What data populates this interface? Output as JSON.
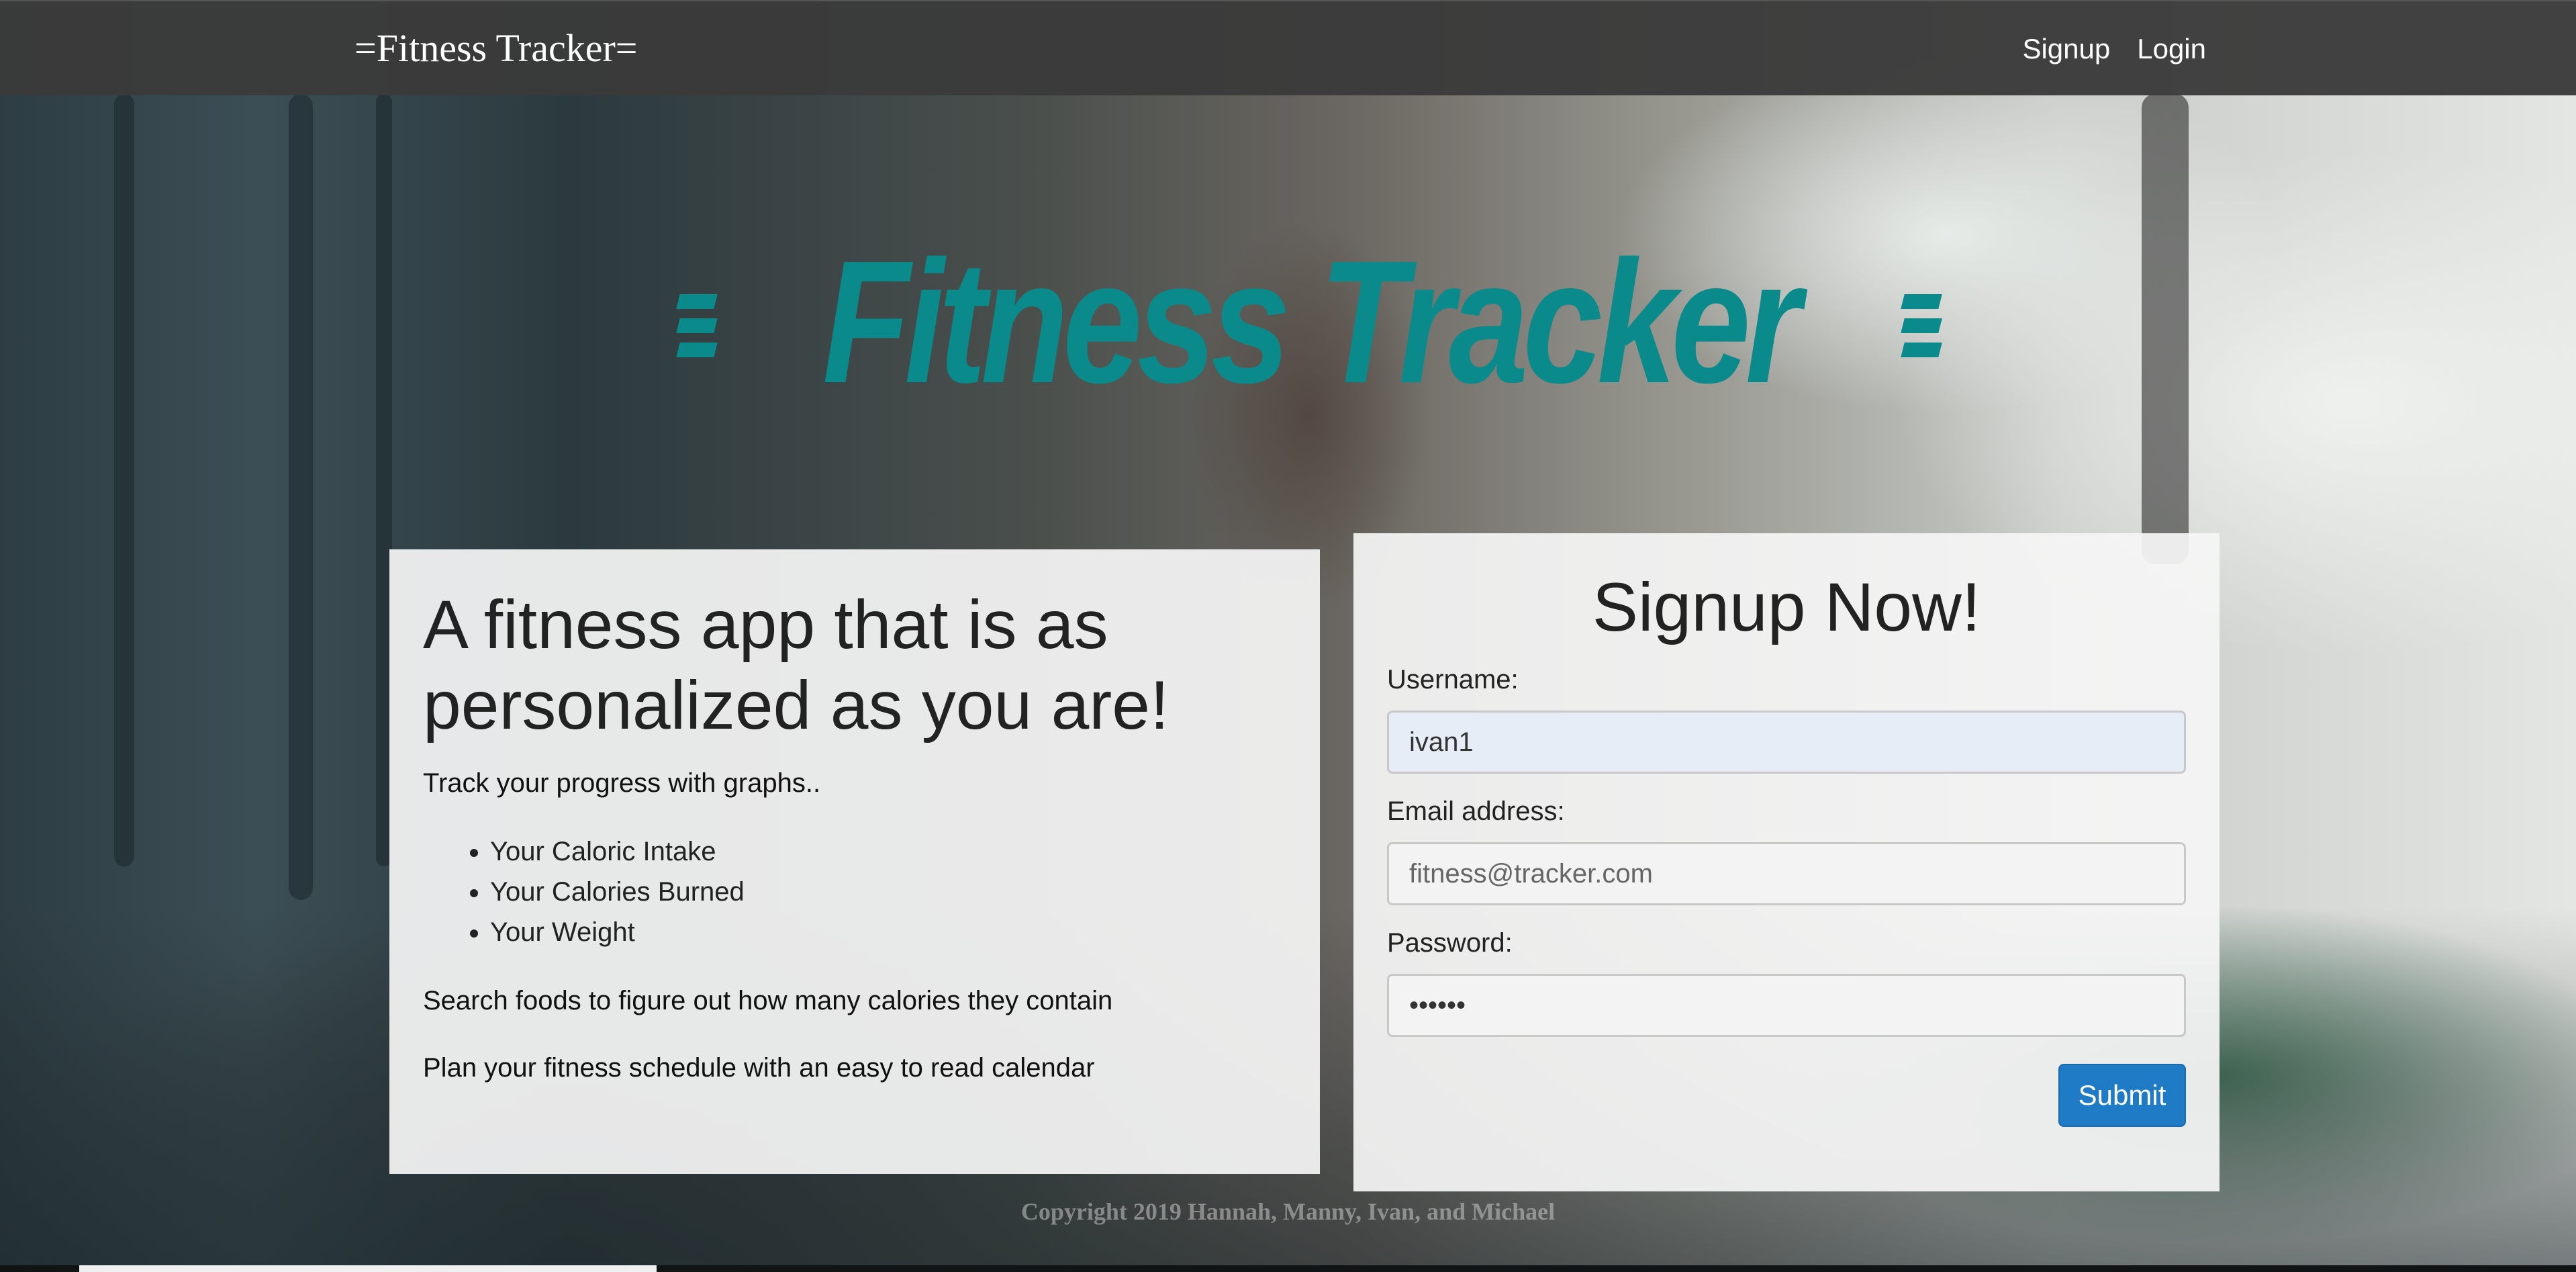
{
  "navbar": {
    "brand": "=Fitness Tracker=",
    "links": [
      "Signup",
      "Login"
    ]
  },
  "hero": {
    "logo_text": "Fitness Tracker",
    "logo_color": "#0a8a8a"
  },
  "info": {
    "heading": "A fitness app that is as personalized as you are!",
    "graphs_line": "Track your progress with graphs..",
    "graph_items": [
      "Your Caloric Intake",
      "Your Calories Burned",
      "Your Weight"
    ],
    "search_line": "Search foods to figure out how many calories they contain",
    "calendar_line": "Plan your fitness schedule with an easy to read calendar"
  },
  "signup": {
    "title": "Signup Now!",
    "username_label": "Username:",
    "username_value": "ivan1",
    "email_label": "Email address:",
    "email_placeholder": "fitness@tracker.com",
    "password_label": "Password:",
    "password_value": "••••••",
    "submit_label": "Submit",
    "submit_color": "#1f7bc5"
  },
  "footer": {
    "copyright": "Copyright 2019 Hannah, Manny, Ivan, and Michael"
  }
}
